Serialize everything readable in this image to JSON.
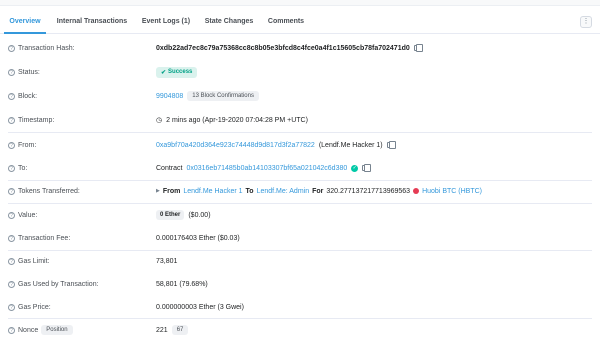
{
  "tabs": [
    {
      "label": "Overview"
    },
    {
      "label": "Internal Transactions"
    },
    {
      "label": "Event Logs (1)"
    },
    {
      "label": "State Changes"
    },
    {
      "label": "Comments"
    }
  ],
  "more_menu": {
    "icon": "vertical-dots-icon",
    "label": "⋮"
  },
  "rows": {
    "tx_hash": {
      "label": "Transaction Hash:",
      "value": "0xdb22ad7ec8c79a75368cc8c8b05e3bfcd8c4fce0a4f1c15605cb78fa702471d0"
    },
    "status": {
      "label": "Status:",
      "value": "Success"
    },
    "block": {
      "label": "Block:",
      "value": "9904808",
      "confirmations": "13 Block Confirmations"
    },
    "timestamp": {
      "label": "Timestamp:",
      "value": "2 mins ago (Apr-19-2020 07:04:28 PM +UTC)"
    },
    "from": {
      "label": "From:",
      "address": "0xa9bf70a420d364e923c74448d9d817d3f2a77822",
      "name": "(Lendf.Me Hacker 1)"
    },
    "to": {
      "label": "To:",
      "prefix": "Contract",
      "address": "0x0316eb71485b0ab14103307bf65a021042c6d380"
    },
    "tokens": {
      "label": "Tokens Transferred:",
      "from_label": "From",
      "from": "Lendf.Me Hacker 1",
      "to_label": "To",
      "to": "Lendf.Me: Admin",
      "for_label": "For",
      "amount": "320.277137217713969563",
      "token": "Huobi BTC (HBTC)"
    },
    "value": {
      "label": "Value:",
      "ether": "0 Ether",
      "usd": "($0.00)"
    },
    "fee": {
      "label": "Transaction Fee:",
      "value": "0.000176403 Ether ($0.03)"
    },
    "gas_limit": {
      "label": "Gas Limit:",
      "value": "73,801"
    },
    "gas_used": {
      "label": "Gas Used by Transaction:",
      "value": "58,801 (79.68%)"
    },
    "gas_price": {
      "label": "Gas Price:",
      "value": "0.000000003 Ether (3 Gwei)"
    },
    "nonce": {
      "label": "Nonce",
      "position_label": "Position",
      "value": "221",
      "position": "67"
    }
  },
  "colors": {
    "accent": "#3498db",
    "success": "#00a186",
    "token": "#e53b54"
  }
}
